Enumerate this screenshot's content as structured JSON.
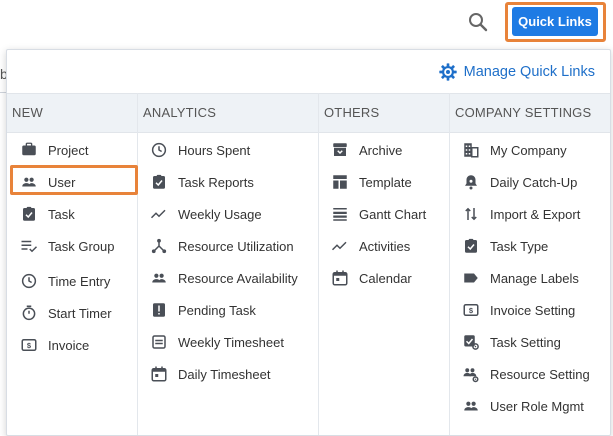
{
  "header": {
    "quick_links_label": "Quick Links",
    "behind_text": "b"
  },
  "panel": {
    "manage_label": "Manage Quick Links",
    "columns": [
      {
        "title": "NEW",
        "items": [
          {
            "label": "Project",
            "icon": "briefcase-icon"
          },
          {
            "label": "User",
            "icon": "users-icon"
          },
          {
            "label": "Task",
            "icon": "task-check-icon"
          },
          {
            "label": "Task Group",
            "icon": "list-check-icon"
          },
          {
            "label": "Time Entry",
            "icon": "clock-icon"
          },
          {
            "label": "Start Timer",
            "icon": "timer-icon"
          },
          {
            "label": "Invoice",
            "icon": "invoice-icon"
          }
        ]
      },
      {
        "title": "ANALYTICS",
        "items": [
          {
            "label": "Hours Spent",
            "icon": "clock-icon"
          },
          {
            "label": "Task Reports",
            "icon": "task-check-icon"
          },
          {
            "label": "Weekly Usage",
            "icon": "trend-icon"
          },
          {
            "label": "Resource Utilization",
            "icon": "hierarchy-icon"
          },
          {
            "label": "Resource Availability",
            "icon": "users-icon"
          },
          {
            "label": "Pending Task",
            "icon": "alert-icon"
          },
          {
            "label": "Weekly Timesheet",
            "icon": "timesheet-icon"
          },
          {
            "label": "Daily Timesheet",
            "icon": "calendar-icon"
          }
        ]
      },
      {
        "title": "OTHERS",
        "items": [
          {
            "label": "Archive",
            "icon": "archive-icon"
          },
          {
            "label": "Template",
            "icon": "template-icon"
          },
          {
            "label": "Gantt Chart",
            "icon": "gantt-icon"
          },
          {
            "label": "Activities",
            "icon": "trend-icon"
          },
          {
            "label": "Calendar",
            "icon": "calendar-icon"
          }
        ]
      },
      {
        "title": "COMPANY SETTINGS",
        "items": [
          {
            "label": "My Company",
            "icon": "building-icon"
          },
          {
            "label": "Daily Catch-Up",
            "icon": "bell-icon"
          },
          {
            "label": "Import & Export",
            "icon": "import-export-icon"
          },
          {
            "label": "Task Type",
            "icon": "task-check-icon"
          },
          {
            "label": "Manage Labels",
            "icon": "label-icon"
          },
          {
            "label": "Invoice Setting",
            "icon": "invoice-icon"
          },
          {
            "label": "Task Setting",
            "icon": "task-setting-icon"
          },
          {
            "label": "Resource Setting",
            "icon": "users-setting-icon"
          },
          {
            "label": "User Role Mgmt",
            "icon": "users-icon"
          }
        ]
      }
    ]
  },
  "colors": {
    "accent": "#1e7be4",
    "highlight": "#e8833a",
    "link": "#1e6fc9",
    "header_bg": "#eef2f6",
    "icon": "#4a4f57"
  }
}
